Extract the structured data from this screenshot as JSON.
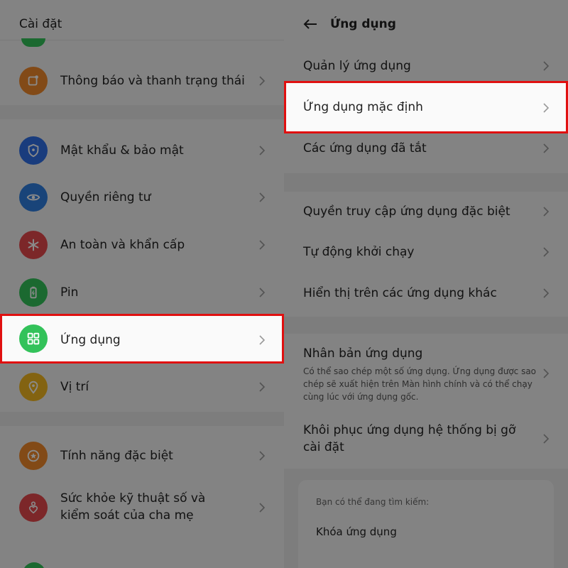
{
  "left": {
    "title": "Cài đặt",
    "items": [
      {
        "label": "Thông báo và thanh trạng thái",
        "icon": "notification-icon",
        "color": "#f08a2c"
      },
      {
        "label": "Mật khẩu & bảo mật",
        "icon": "shield-icon",
        "color": "#2f6fe8"
      },
      {
        "label": "Quyền riêng tư",
        "icon": "privacy-eye-icon",
        "color": "#2f7fe0"
      },
      {
        "label": "An toàn và khẩn cấp",
        "icon": "emergency-icon",
        "color": "#e5484d"
      },
      {
        "label": "Pin",
        "icon": "battery-icon",
        "color": "#33c25a"
      },
      {
        "label": "Ứng dụng",
        "icon": "apps-grid-icon",
        "color": "#33c25a"
      },
      {
        "label": "Vị trí",
        "icon": "location-pin-icon",
        "color": "#f2b820"
      },
      {
        "label": "Tính năng đặc biệt",
        "icon": "star-icon",
        "color": "#f08a2c"
      },
      {
        "label": "Sức khỏe kỹ thuật số và kiểm soát của cha mẹ",
        "icon": "heart-person-icon",
        "color": "#e5484d"
      }
    ]
  },
  "right": {
    "title": "Ứng dụng",
    "items": [
      {
        "label": "Quản lý ứng dụng"
      },
      {
        "label": "Ứng dụng mặc định"
      },
      {
        "label": "Các ứng dụng đã tắt"
      },
      {
        "label": "Quyền truy cập ứng dụng đặc biệt"
      },
      {
        "label": "Tự động khởi chạy"
      },
      {
        "label": "Hiển thị trên các ứng dụng khác"
      },
      {
        "label": "Nhân bản ứng dụng",
        "desc": "Có thể sao chép một số ứng dụng. Ứng dụng được sao chép sẽ xuất hiện trên Màn hình chính và có thể chạy cùng lúc với ứng dụng gốc."
      },
      {
        "label": "Khôi phục ứng dụng hệ thống bị gỡ cài đặt"
      }
    ],
    "suggest": {
      "heading": "Bạn có thể đang tìm kiếm:",
      "item": "Khóa ứng dụng"
    }
  },
  "colors": {
    "highlight": "#e01010",
    "chevron": "#9a9a9a"
  }
}
